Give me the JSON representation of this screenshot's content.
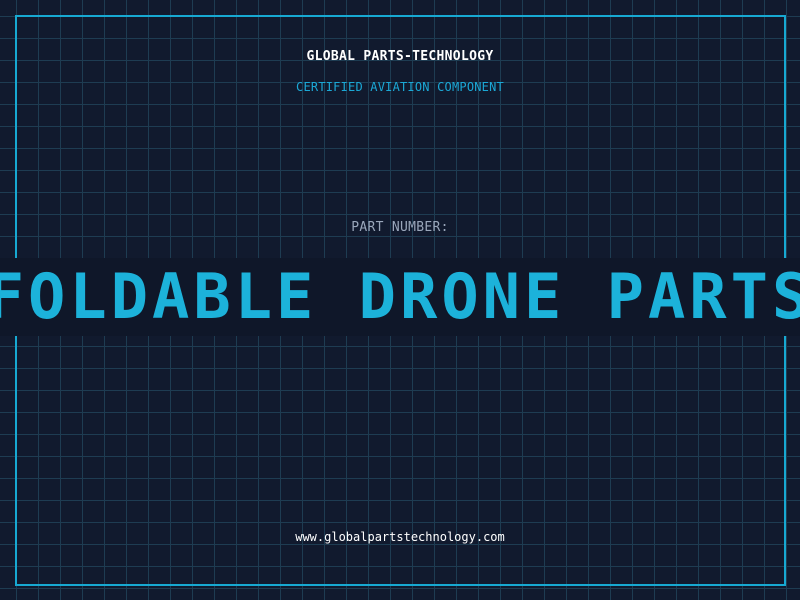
{
  "brand": {
    "name": "GLOBAL PARTS-TECHNOLOGY",
    "tagline": "CERTIFIED AVIATION COMPONENT"
  },
  "part": {
    "label": "PART NUMBER:",
    "value": "FOLDABLE DRONE PARTS"
  },
  "footer": {
    "website": "www.globalpartstechnology.com"
  },
  "colors": {
    "background": "#111a2e",
    "grid": "#1e3c52",
    "accent": "#17a9d2",
    "text_primary": "#ffffff",
    "text_muted": "#9aa7bb"
  }
}
